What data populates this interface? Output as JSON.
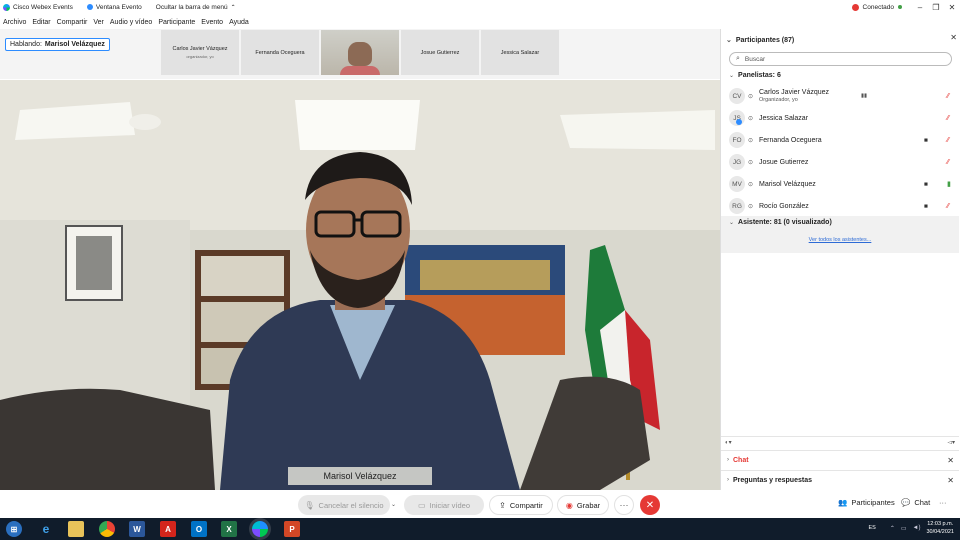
{
  "titlebar": {
    "app_name": "Cisco Webex Events",
    "event_window": "Ventana Evento",
    "hide_menu": "Ocultar la barra de menú",
    "status": "Conectado"
  },
  "menu": [
    "Archivo",
    "Editar",
    "Compartir",
    "Ver",
    "Audio y vídeo",
    "Participante",
    "Evento",
    "Ayuda"
  ],
  "strip": {
    "speaking_label": "Hablando:",
    "speaking_name": "Marisol Velázquez",
    "thumbs": [
      {
        "name": "Carlos Javier Vázquez",
        "sub": "organizador, yo"
      },
      {
        "name": "Fernanda Oceguera",
        "sub": ""
      },
      {
        "name": "",
        "sub": ""
      },
      {
        "name": "Josue Gutierrez",
        "sub": ""
      },
      {
        "name": "Jessica Salazar",
        "sub": ""
      }
    ]
  },
  "video": {
    "speaker_caption": "Marisol Velázquez"
  },
  "controls": {
    "mute": "Cancelar el silencio",
    "video": "Iniciar vídeo",
    "share": "Compartir",
    "record": "Grabar",
    "participants": "Participantes",
    "chat": "Chat"
  },
  "panel": {
    "title": "Participantes (87)",
    "search_placeholder": "Buscar",
    "panelists_label": "Panelistas: 6",
    "panelists": [
      {
        "initials": "CV",
        "name": "Carlos Javier Vázquez",
        "sub": "Organizador, yo",
        "cam": false,
        "mic": "muted",
        "signal": true,
        "badge": false
      },
      {
        "initials": "JS",
        "name": "Jessica Salazar",
        "sub": "",
        "cam": false,
        "mic": "muted",
        "signal": false,
        "badge": true
      },
      {
        "initials": "FO",
        "name": "Fernanda Oceguera",
        "sub": "",
        "cam": true,
        "mic": "muted",
        "signal": false,
        "badge": false
      },
      {
        "initials": "JG",
        "name": "Josue Gutierrez",
        "sub": "",
        "cam": false,
        "mic": "muted",
        "signal": false,
        "badge": false
      },
      {
        "initials": "MV",
        "name": "Marisol Velázquez",
        "sub": "",
        "cam": true,
        "mic": "on",
        "signal": false,
        "badge": false
      },
      {
        "initials": "RG",
        "name": "Rocío González",
        "sub": "",
        "cam": true,
        "mic": "muted",
        "signal": false,
        "badge": false
      }
    ],
    "attendees_label": "Asistente: 81 (0 visualizado)",
    "see_all": "Ver todos los asistentes...",
    "chat_section": "Chat",
    "qa_section": "Preguntas y respuestas"
  },
  "taskbar": {
    "lang": "ES",
    "time": "12:03 p.m.",
    "date": "30/04/2021"
  },
  "colors": {
    "accent": "#2d8cff",
    "danger": "#e53935",
    "success": "#43a047",
    "taskbar": "#101c2b"
  }
}
